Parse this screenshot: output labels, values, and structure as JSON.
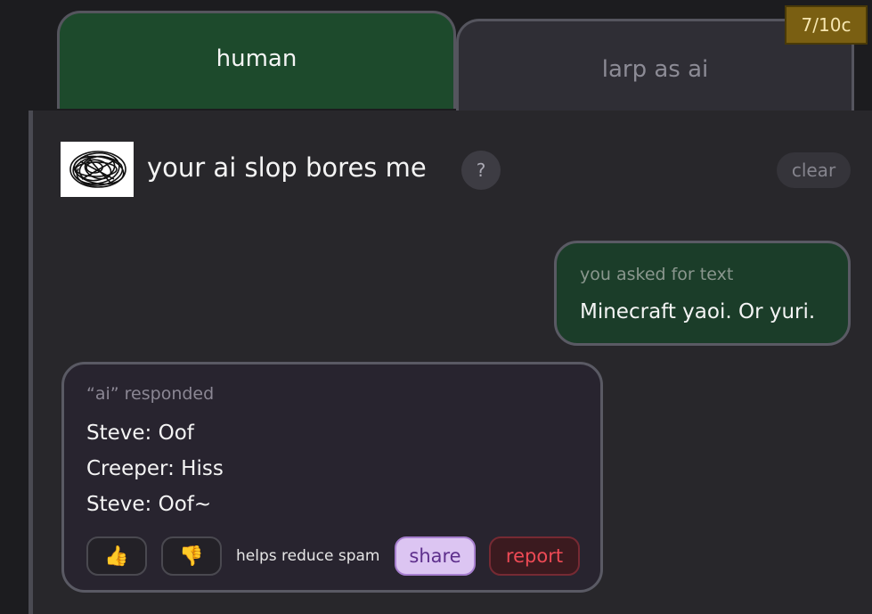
{
  "tabs": {
    "human_label": "human",
    "ai_label": "larp as ai"
  },
  "credits": "7/10c",
  "header": {
    "title": "your ai slop bores me",
    "help_label": "?",
    "clear_label": "clear"
  },
  "user_message": {
    "caption": "you asked for text",
    "text": "Minecraft yaoi. Or yuri."
  },
  "ai_message": {
    "caption": "“ai” responded",
    "lines": [
      "Steve: Oof",
      "Creeper: Hiss",
      "Steve: Oof~"
    ],
    "thumbs_up": "👍",
    "thumbs_down": "👎",
    "spam_note": "helps reduce spam",
    "share_label": "share",
    "report_label": "report"
  },
  "colors": {
    "human_tab": "#1d4a2c",
    "user_bubble": "#1b3d29",
    "credits_badge": "#7a5f12",
    "share": "#dcc5f2",
    "report": "#ee4a55"
  }
}
